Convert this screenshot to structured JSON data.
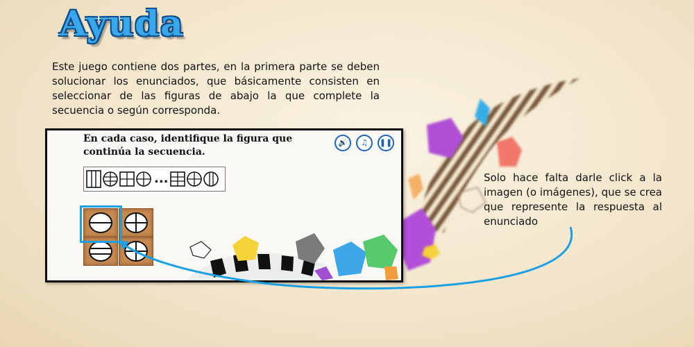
{
  "help_screen": {
    "title": "Ayuda",
    "intro": "Este juego contiene dos partes, en la primera parte se deben solucionar los enunciados, que básicamente consisten en seleccionar de las figuras de abajo la que complete la secuencia o según corresponda.",
    "note": "Solo hace falta darle click a la imagen (o imágenes), que se crea que represente la respuesta al enunciado"
  },
  "example_screen": {
    "instruction": "En cada caso, identifique la figura que continúa la secuencia.",
    "sequence_ellipsis": "...",
    "sequence_left": [
      "rect-vertical-lines",
      "circle-cross-hatched",
      "square-grid",
      "circle-grid"
    ],
    "sequence_right": [
      "square-grid",
      "circle-grid",
      "circle-vertical-lines"
    ],
    "options": [
      {
        "figure": "circle-horizontal-line",
        "selected": true
      },
      {
        "figure": "circle-cross",
        "selected": false
      },
      {
        "figure": "circle-double-horizontal-lines",
        "selected": false
      },
      {
        "figure": "circle-cross-vertical",
        "selected": false
      }
    ],
    "controls": [
      {
        "icon": "speaker-icon",
        "glyph": "🔊"
      },
      {
        "icon": "music-note-icon",
        "glyph": "♫"
      },
      {
        "icon": "pause-icon",
        "glyph": "❚❚"
      }
    ]
  },
  "colors": {
    "title_fill": "#3aa7ea",
    "title_outline": "#0d4f8c",
    "highlight": "#1aa0e3",
    "arrow": "#1aa0e3",
    "tile": "#c98a52"
  }
}
